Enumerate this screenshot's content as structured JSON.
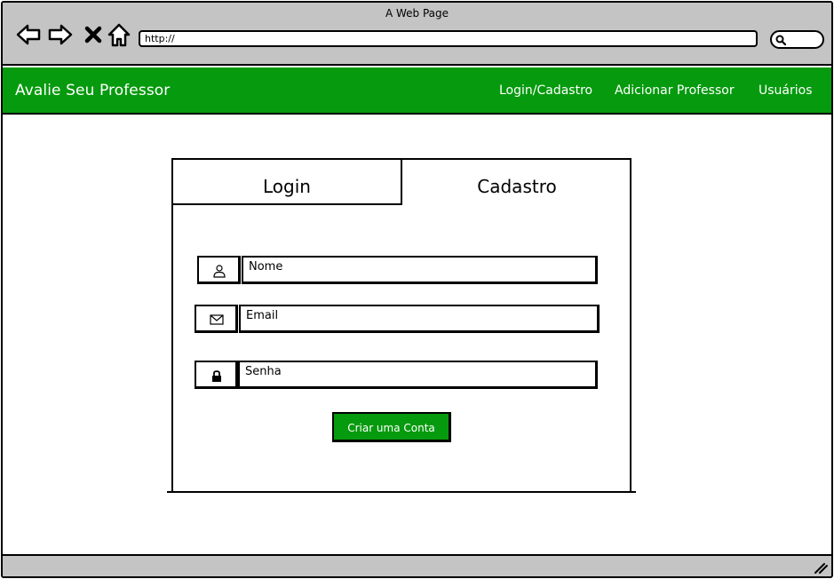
{
  "browser": {
    "window_title": "A Web Page",
    "url": "http://",
    "nav_icons": [
      "back-arrow-icon",
      "forward-arrow-icon",
      "stop-x-icon",
      "home-icon"
    ],
    "search_icon": "search-icon"
  },
  "app_nav": {
    "brand": "Avalie Seu Professor",
    "links": [
      "Login/Cadastro",
      "Adicionar Professor",
      "Usuários"
    ],
    "background_color": "#069a0e"
  },
  "form": {
    "tabs": [
      "Login",
      "Cadastro"
    ],
    "active_tab": "Cadastro",
    "fields": [
      {
        "icon": "user-icon",
        "placeholder": "Nome"
      },
      {
        "icon": "envelope-icon",
        "placeholder": "Email"
      },
      {
        "icon": "lock-icon",
        "placeholder": "Senha"
      }
    ],
    "submit_label": "Criar uma Conta"
  }
}
